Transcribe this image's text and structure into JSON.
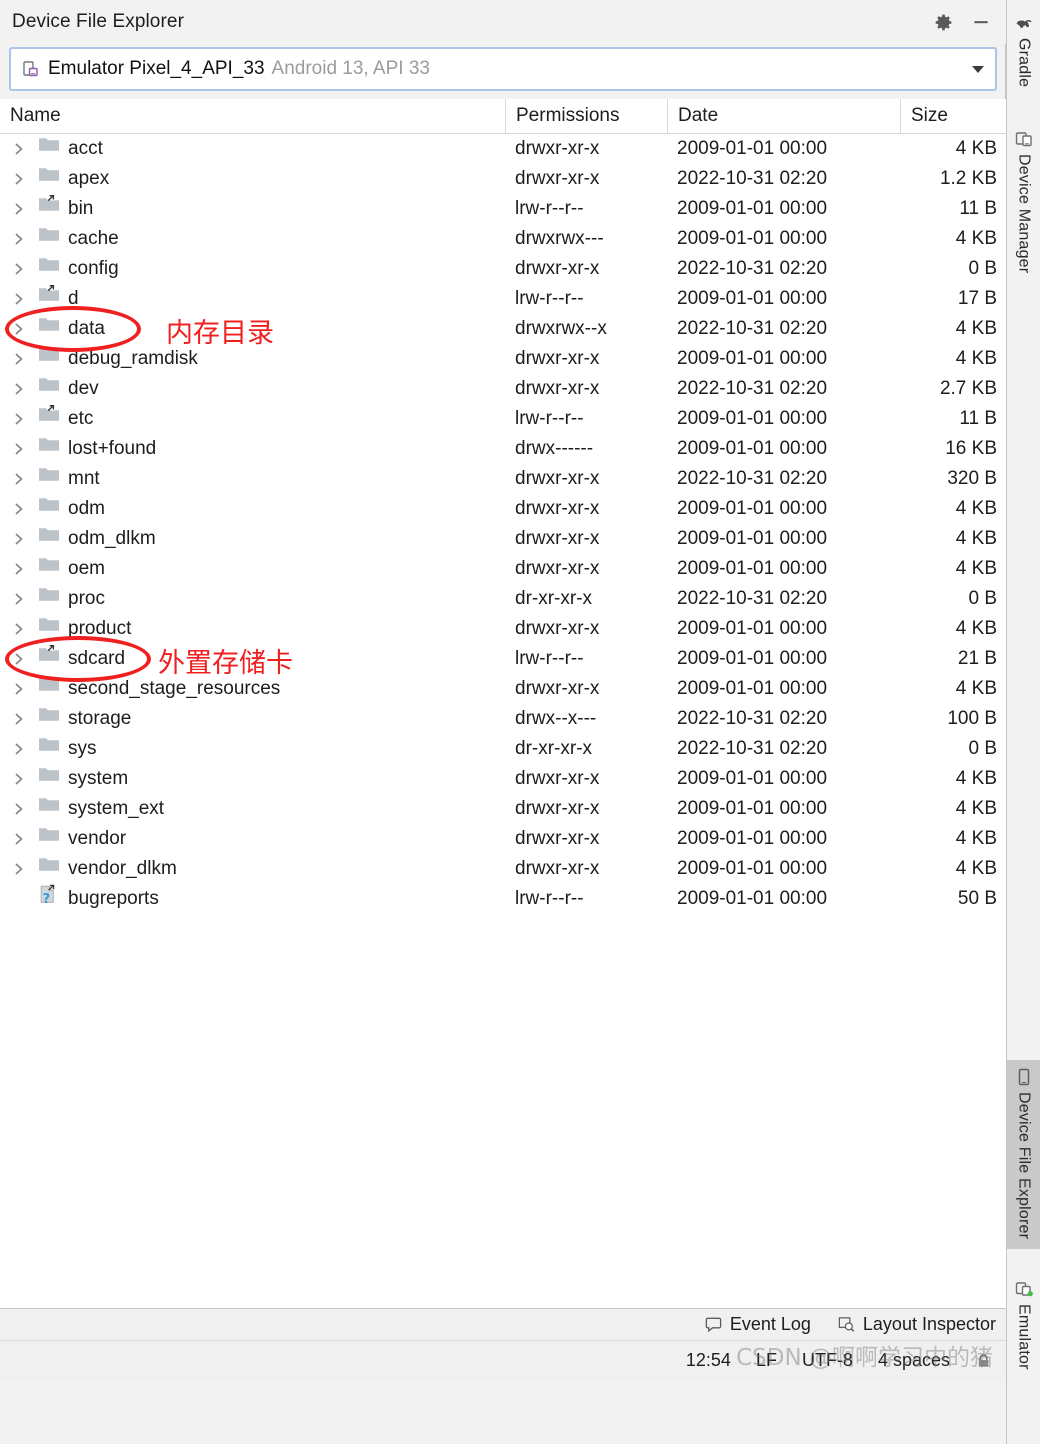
{
  "window": {
    "title": "Device File Explorer",
    "settings_icon": "gear-icon",
    "minimize_icon": "minimize-icon"
  },
  "device_selector": {
    "icon": "device-phone-icon",
    "device_name": "Emulator Pixel_4_API_33",
    "device_detail": "Android 13, API 33",
    "dropdown_icon": "chevron-down-icon"
  },
  "table": {
    "columns": [
      "Name",
      "Permissions",
      "Date",
      "Size"
    ],
    "rows": [
      {
        "name": "acct",
        "icon": "folder-icon",
        "expandable": true,
        "permissions": "drwxr-xr-x",
        "date": "2009-01-01 00:00",
        "size": "4 KB"
      },
      {
        "name": "apex",
        "icon": "folder-icon",
        "expandable": true,
        "permissions": "drwxr-xr-x",
        "date": "2022-10-31 02:20",
        "size": "1.2 KB"
      },
      {
        "name": "bin",
        "icon": "folder-link-icon",
        "expandable": true,
        "permissions": "lrw-r--r--",
        "date": "2009-01-01 00:00",
        "size": "11 B"
      },
      {
        "name": "cache",
        "icon": "folder-icon",
        "expandable": true,
        "permissions": "drwxrwx---",
        "date": "2009-01-01 00:00",
        "size": "4 KB"
      },
      {
        "name": "config",
        "icon": "folder-icon",
        "expandable": true,
        "permissions": "drwxr-xr-x",
        "date": "2022-10-31 02:20",
        "size": "0 B"
      },
      {
        "name": "d",
        "icon": "folder-link-icon",
        "expandable": true,
        "permissions": "lrw-r--r--",
        "date": "2009-01-01 00:00",
        "size": "17 B"
      },
      {
        "name": "data",
        "icon": "folder-icon",
        "expandable": true,
        "permissions": "drwxrwx--x",
        "date": "2022-10-31 02:20",
        "size": "4 KB"
      },
      {
        "name": "debug_ramdisk",
        "icon": "folder-icon",
        "expandable": true,
        "permissions": "drwxr-xr-x",
        "date": "2009-01-01 00:00",
        "size": "4 KB"
      },
      {
        "name": "dev",
        "icon": "folder-icon",
        "expandable": true,
        "permissions": "drwxr-xr-x",
        "date": "2022-10-31 02:20",
        "size": "2.7 KB"
      },
      {
        "name": "etc",
        "icon": "folder-link-icon",
        "expandable": true,
        "permissions": "lrw-r--r--",
        "date": "2009-01-01 00:00",
        "size": "11 B"
      },
      {
        "name": "lost+found",
        "icon": "folder-icon",
        "expandable": true,
        "permissions": "drwx------",
        "date": "2009-01-01 00:00",
        "size": "16 KB"
      },
      {
        "name": "mnt",
        "icon": "folder-icon",
        "expandable": true,
        "permissions": "drwxr-xr-x",
        "date": "2022-10-31 02:20",
        "size": "320 B"
      },
      {
        "name": "odm",
        "icon": "folder-icon",
        "expandable": true,
        "permissions": "drwxr-xr-x",
        "date": "2009-01-01 00:00",
        "size": "4 KB"
      },
      {
        "name": "odm_dlkm",
        "icon": "folder-icon",
        "expandable": true,
        "permissions": "drwxr-xr-x",
        "date": "2009-01-01 00:00",
        "size": "4 KB"
      },
      {
        "name": "oem",
        "icon": "folder-icon",
        "expandable": true,
        "permissions": "drwxr-xr-x",
        "date": "2009-01-01 00:00",
        "size": "4 KB"
      },
      {
        "name": "proc",
        "icon": "folder-icon",
        "expandable": true,
        "permissions": "dr-xr-xr-x",
        "date": "2022-10-31 02:20",
        "size": "0 B"
      },
      {
        "name": "product",
        "icon": "folder-icon",
        "expandable": true,
        "permissions": "drwxr-xr-x",
        "date": "2009-01-01 00:00",
        "size": "4 KB"
      },
      {
        "name": "sdcard",
        "icon": "folder-link-icon",
        "expandable": true,
        "permissions": "lrw-r--r--",
        "date": "2009-01-01 00:00",
        "size": "21 B"
      },
      {
        "name": "second_stage_resources",
        "icon": "folder-icon",
        "expandable": true,
        "permissions": "drwxr-xr-x",
        "date": "2009-01-01 00:00",
        "size": "4 KB"
      },
      {
        "name": "storage",
        "icon": "folder-icon",
        "expandable": true,
        "permissions": "drwx--x---",
        "date": "2022-10-31 02:20",
        "size": "100 B"
      },
      {
        "name": "sys",
        "icon": "folder-icon",
        "expandable": true,
        "permissions": "dr-xr-xr-x",
        "date": "2022-10-31 02:20",
        "size": "0 B"
      },
      {
        "name": "system",
        "icon": "folder-icon",
        "expandable": true,
        "permissions": "drwxr-xr-x",
        "date": "2009-01-01 00:00",
        "size": "4 KB"
      },
      {
        "name": "system_ext",
        "icon": "folder-icon",
        "expandable": true,
        "permissions": "drwxr-xr-x",
        "date": "2009-01-01 00:00",
        "size": "4 KB"
      },
      {
        "name": "vendor",
        "icon": "folder-icon",
        "expandable": true,
        "permissions": "drwxr-xr-x",
        "date": "2009-01-01 00:00",
        "size": "4 KB"
      },
      {
        "name": "vendor_dlkm",
        "icon": "folder-icon",
        "expandable": true,
        "permissions": "drwxr-xr-x",
        "date": "2009-01-01 00:00",
        "size": "4 KB"
      },
      {
        "name": "bugreports",
        "icon": "file-link-unknown-icon",
        "expandable": false,
        "permissions": "lrw-r--r--",
        "date": "2009-01-01 00:00",
        "size": "50 B"
      }
    ]
  },
  "annotations": {
    "color": "#f02020",
    "items": [
      {
        "label": "内存目录",
        "target": "data"
      },
      {
        "label": "外置存储卡",
        "target": "sdcard"
      }
    ]
  },
  "tool_strip": {
    "top": [
      {
        "label": "Gradle",
        "icon": "gradle-elephant-icon",
        "active": false
      },
      {
        "label": "Device Manager",
        "icon": "device-manager-icon",
        "active": false
      }
    ],
    "bottom": [
      {
        "label": "Device File Explorer",
        "icon": "device-file-explorer-icon",
        "active": true
      },
      {
        "label": "Emulator",
        "icon": "emulator-icon",
        "active": false
      }
    ]
  },
  "status_bar": {
    "tools": [
      {
        "label": "Event Log",
        "icon": "event-log-icon"
      },
      {
        "label": "Layout Inspector",
        "icon": "layout-inspector-icon"
      }
    ],
    "fields": [
      "12:54",
      "LF",
      "UTF-8",
      "4 spaces"
    ],
    "lock_icon": "lock-icon"
  },
  "watermark": "CSDN @啊啊学习中的猪"
}
